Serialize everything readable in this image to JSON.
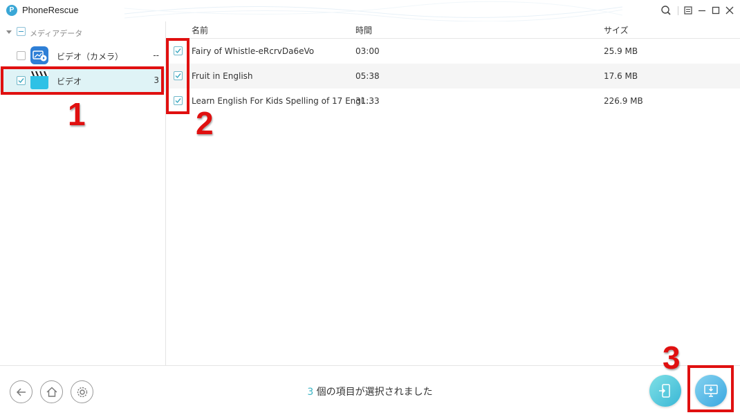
{
  "app": {
    "title": "PhoneRescue",
    "logo_letter": "P"
  },
  "sidebar": {
    "root_label": "メディアデータ",
    "items": [
      {
        "label": "ビデオ（カメラ）",
        "count": "--",
        "checked": false,
        "icon": "camera-video-icon"
      },
      {
        "label": "ビデオ",
        "count": "3",
        "checked": true,
        "icon": "clapperboard-icon"
      }
    ]
  },
  "table": {
    "columns": {
      "name": "名前",
      "time": "時間",
      "size": "サイズ"
    },
    "rows": [
      {
        "name": "Fairy of  Whistle-eRcrvDa6eVo",
        "time": "03:00",
        "size": "25.9 MB",
        "checked": true
      },
      {
        "name": "Fruit in English",
        "time": "05:38",
        "size": "17.6 MB",
        "checked": true
      },
      {
        "name": "Learn English For Kids  Spelling of 17 Engl...",
        "time": "31:33",
        "size": "226.9 MB",
        "checked": true
      }
    ]
  },
  "footer": {
    "selected_count": "3",
    "status_text": " 個の項目が選択されました"
  },
  "annotations": {
    "step1": "1",
    "step2": "2",
    "step3": "3"
  },
  "colors": {
    "accent": "#3ab4c4",
    "annotation": "#e01010",
    "selected_bg": "#dff3f6"
  }
}
